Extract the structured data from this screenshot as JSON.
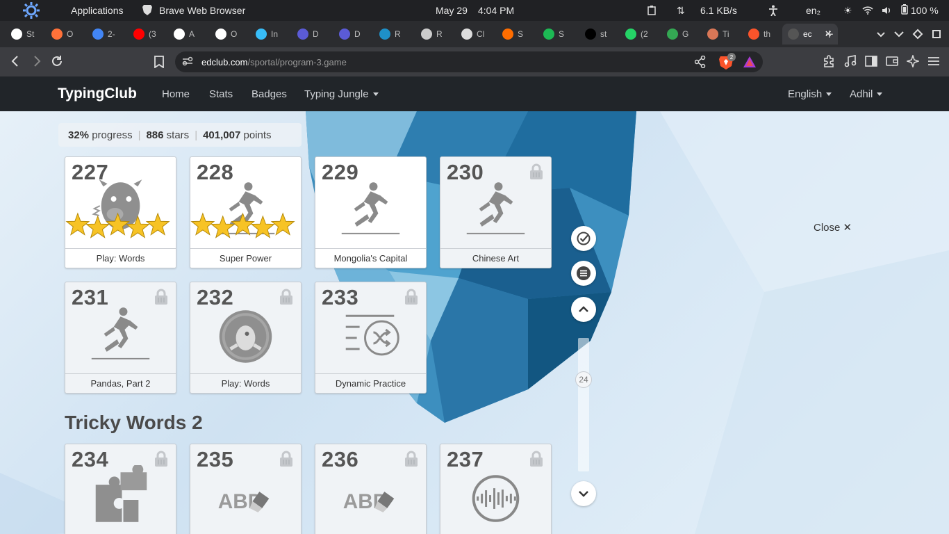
{
  "system_bar": {
    "applications": "Applications",
    "window_title": "Brave Web Browser",
    "date": "May 29",
    "time": "4:04 PM",
    "network_speed": "6.1 KB/s",
    "keyboard_layout": "en₂",
    "battery": "100 %"
  },
  "tabs": [
    {
      "label": "St",
      "icon": "openai-icon",
      "color": "#ffffff"
    },
    {
      "label": "O",
      "icon": "firefox-icon",
      "color": "#ff7139"
    },
    {
      "label": "2-",
      "icon": "google-icon",
      "color": "#4285f4"
    },
    {
      "label": "(3",
      "icon": "youtube-icon",
      "color": "#ff0000"
    },
    {
      "label": "A",
      "icon": "github-icon",
      "color": "#ffffff"
    },
    {
      "label": "O",
      "icon": "github-icon",
      "color": "#ffffff"
    },
    {
      "label": "In",
      "icon": "tailwind-icon",
      "color": "#38bdf8"
    },
    {
      "label": "D",
      "icon": "devtools-icon",
      "color": "#5b5bd6"
    },
    {
      "label": "D",
      "icon": "devtools-icon",
      "color": "#5b5bd6"
    },
    {
      "label": "R",
      "icon": "react-icon",
      "color": "#1e90c8"
    },
    {
      "label": "R",
      "icon": "router-icon",
      "color": "#cccccc"
    },
    {
      "label": "Cl",
      "icon": "claude-icon",
      "color": "#dddddd"
    },
    {
      "label": "S",
      "icon": "blogger-icon",
      "color": "#ff6d00"
    },
    {
      "label": "S",
      "icon": "spotify-icon",
      "color": "#1db954"
    },
    {
      "label": "st",
      "icon": "app-icon",
      "color": "#000000"
    },
    {
      "label": "(2",
      "icon": "whatsapp-icon",
      "color": "#25d366"
    },
    {
      "label": "G",
      "icon": "google-meet-icon",
      "color": "#34a853"
    },
    {
      "label": "Ti",
      "icon": "claude-star-icon",
      "color": "#d97757"
    },
    {
      "label": "th",
      "icon": "brave-icon",
      "color": "#fb542b"
    },
    {
      "label": "ec",
      "icon": "typingclub-icon",
      "color": "#555555"
    }
  ],
  "address_bar": {
    "domain": "edclub.com",
    "path": "/sportal/program-3.game",
    "shield_count": "2"
  },
  "site_nav": {
    "brand": "TypingClub",
    "links": [
      "Home",
      "Stats",
      "Badges",
      "Typing Jungle"
    ],
    "language": "English",
    "user": "Adhil"
  },
  "progress": {
    "percent": "32%",
    "percent_label": "progress",
    "stars": "886",
    "stars_label": "stars",
    "points": "401,007",
    "points_label": "points"
  },
  "lessons": [
    {
      "num": "227",
      "label": "Play: Words",
      "locked": false,
      "stars": 5,
      "art": "monster"
    },
    {
      "num": "228",
      "label": "Super Power",
      "locked": false,
      "stars": 5,
      "art": "runner"
    },
    {
      "num": "229",
      "label": "Mongolia's Capital",
      "locked": false,
      "stars": 0,
      "art": "runner"
    },
    {
      "num": "230",
      "label": "Chinese Art",
      "locked": true,
      "stars": 0,
      "art": "runner"
    },
    {
      "num": "231",
      "label": "Pandas, Part 2",
      "locked": true,
      "stars": 0,
      "art": "runner"
    },
    {
      "num": "232",
      "label": "Play: Words",
      "locked": true,
      "stars": 0,
      "art": "game"
    },
    {
      "num": "233",
      "label": "Dynamic Practice",
      "locked": true,
      "stars": 0,
      "art": "shuffle"
    }
  ],
  "section_title": "Tricky Words 2",
  "section_lessons": [
    {
      "num": "234",
      "locked": true,
      "art": "puzzle"
    },
    {
      "num": "235",
      "locked": true,
      "art": "abc",
      "text": "ABD"
    },
    {
      "num": "236",
      "locked": true,
      "art": "abc",
      "text": "ABD"
    },
    {
      "num": "237",
      "locked": true,
      "art": "audio"
    }
  ],
  "scroller": {
    "indicator": "24"
  },
  "close_label": "Close"
}
